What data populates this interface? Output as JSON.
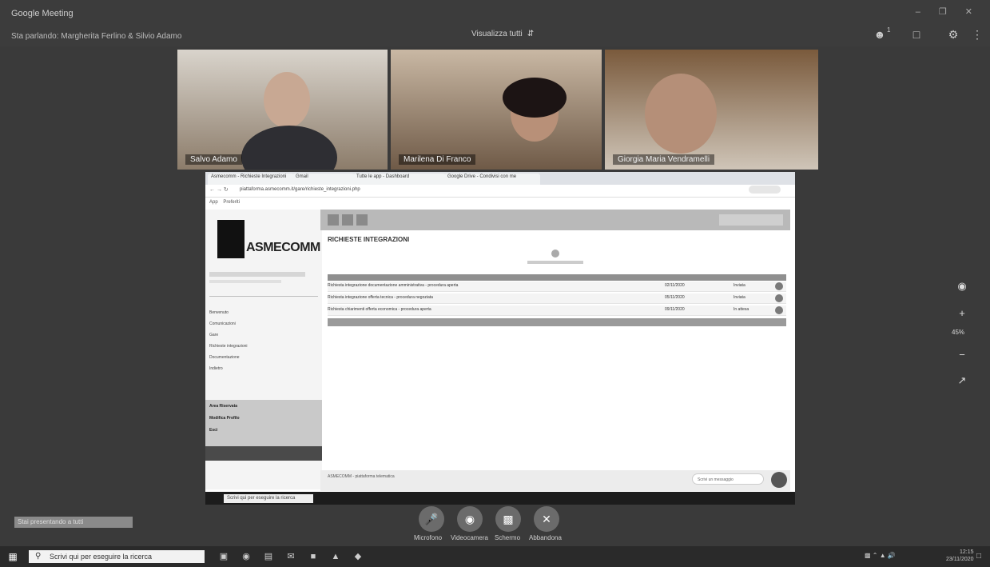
{
  "app": {
    "title": "Google Meeting",
    "presenter_info": "Sta parlando: Margherita Ferlino & Silvio Adamo",
    "view_mode": "Visualizza tutti",
    "people_count": "1"
  },
  "participants": [
    {
      "name": "Salvo Adamo"
    },
    {
      "name": "Marilena Di Franco"
    },
    {
      "name": "Giorgia Maria Vendramelli"
    }
  ],
  "shared_screen": {
    "browser": {
      "tabs": [
        "Asmecomm - Richieste Integrazioni",
        "Gmail",
        "Tutte le app - Dashboard",
        "Google Drive - Condivisi con me"
      ],
      "address": "piattaforma.asmecomm.it/gare/richieste_integrazioni.php",
      "bookmarks": [
        "App",
        "Preferiti"
      ]
    },
    "site": {
      "logo_text": "ASMECOMM",
      "section_title": "RICHIESTE INTEGRAZIONI",
      "side_links": [
        "Benvenuto",
        "Comunicazioni",
        "Gare",
        "Richieste integrazioni",
        "Documentazione",
        "Indietro"
      ],
      "gray_links": [
        "Area Riservata",
        "Modifica Profilo",
        "Esci"
      ],
      "rows": [
        {
          "desc": "Richiesta integrazione documentazione amministrativa - procedura aperta",
          "date": "02/11/2020",
          "status": "Inviata"
        },
        {
          "desc": "Richiesta integrazione offerta tecnica - procedura negoziata",
          "date": "05/11/2020",
          "status": "Inviata"
        },
        {
          "desc": "Richiesta chiarimenti offerta economica - procedura aperta",
          "date": "09/11/2020",
          "status": "In attesa"
        }
      ],
      "footer": "ASMECOMM - piattaforma telematica",
      "chat_placeholder": "Scrivi un messaggio",
      "taskbar_search": "Scrivi qui per eseguire la ricerca"
    }
  },
  "right_tools": {
    "zoom": "45%"
  },
  "notice": "Stai presentando a tutti",
  "controls": [
    {
      "label": "Microfono",
      "icon": "mic-icon",
      "color": "#6b6b6b"
    },
    {
      "label": "Videocamera",
      "icon": "camera-icon",
      "color": "#6b6b6b"
    },
    {
      "label": "Schermo",
      "icon": "screen-share-icon",
      "color": "#6b6b6b"
    },
    {
      "label": "Abbandona",
      "icon": "close-icon",
      "color": "#6b6b6b"
    }
  ],
  "os": {
    "search_placeholder": "Scrivi qui per eseguire la ricerca",
    "time": "12:15",
    "date": "23/11/2020"
  }
}
